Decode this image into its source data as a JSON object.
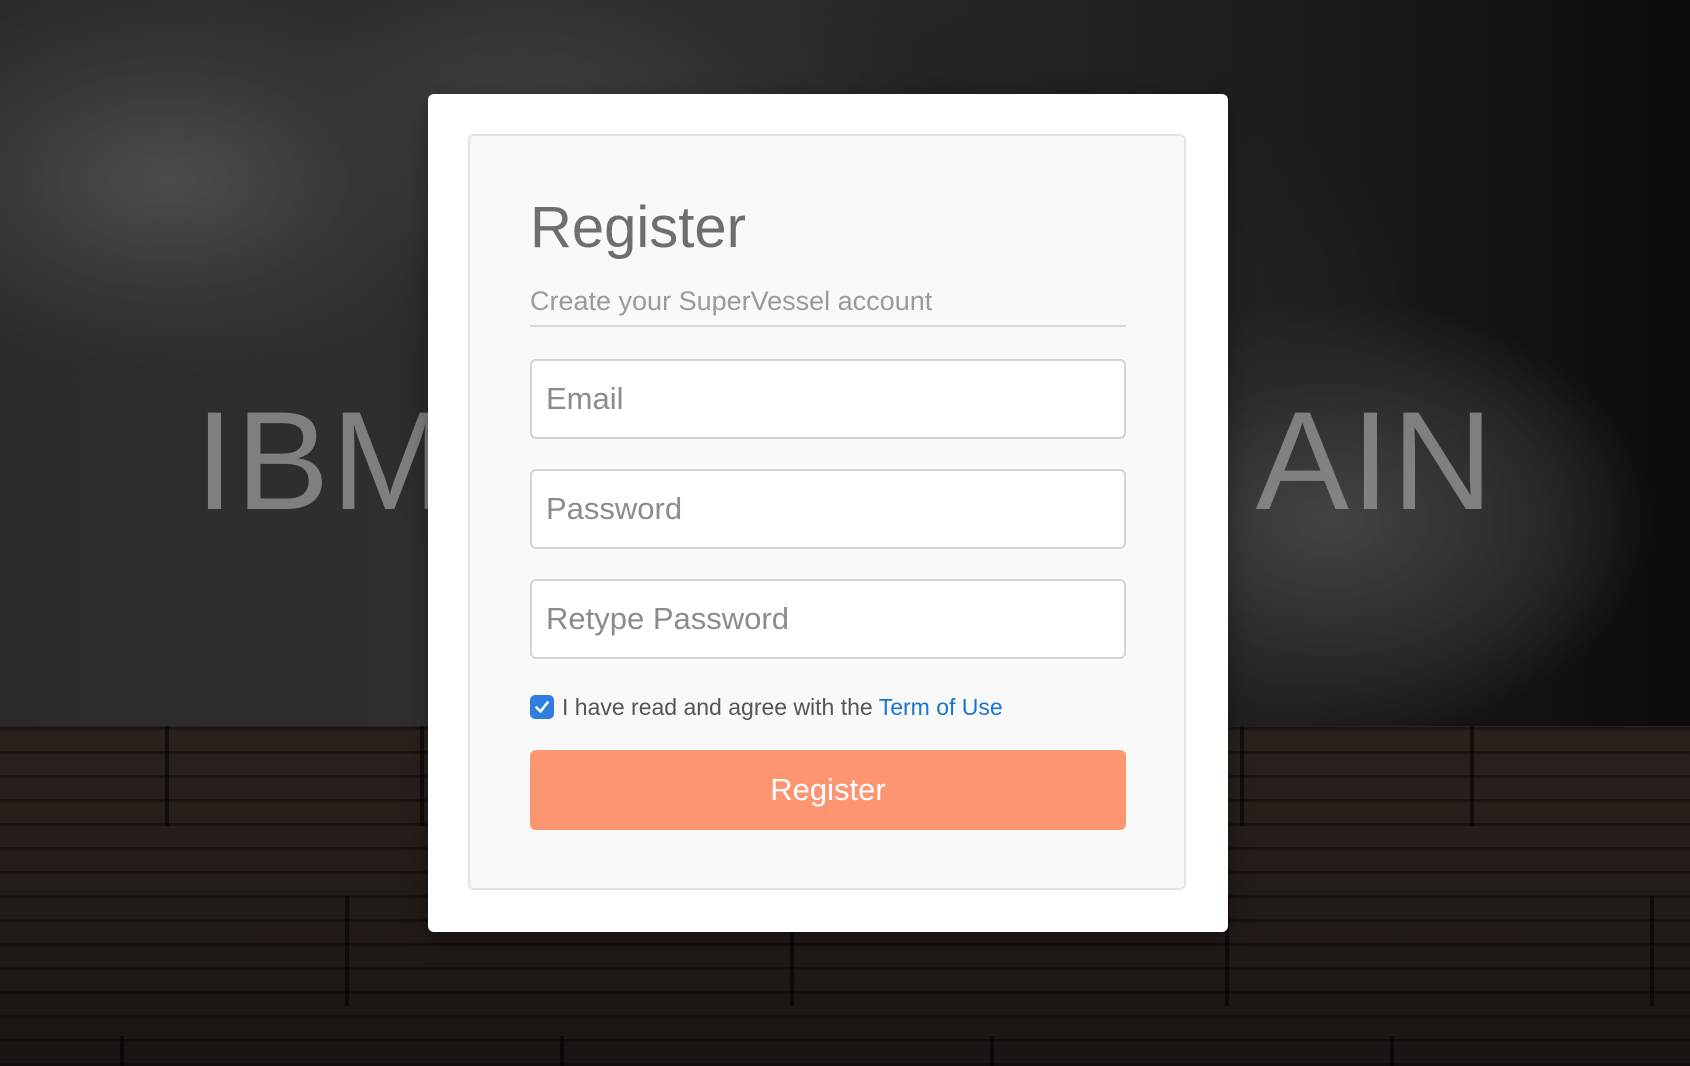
{
  "background": {
    "hero_text_left": "IBM",
    "hero_text_right": "AIN"
  },
  "register_form": {
    "title": "Register",
    "subtitle": "Create your SuperVessel account",
    "email_placeholder": "Email",
    "password_placeholder": "Password",
    "retype_password_placeholder": "Retype Password",
    "agree_checked": true,
    "agree_text": "I have read and agree with the",
    "terms_link": "Term of Use",
    "submit_label": "Register"
  },
  "colors": {
    "accent_button": "#fd9570",
    "link": "#1a74d2",
    "checkbox": "#2f7fe0"
  },
  "icons": {
    "checkbox": "checkmark-icon"
  }
}
